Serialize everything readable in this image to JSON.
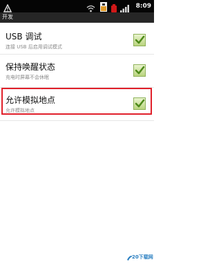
{
  "status_bar": {
    "time": "8:09",
    "icons": [
      "notification-icon",
      "wifi-icon",
      "battery-saver-icon",
      "battery-icon",
      "signal-icon"
    ]
  },
  "title_bar": {
    "title": "开发"
  },
  "settings": [
    {
      "title": "USB 调试",
      "subtitle": "连接 USB 后启用调试模式",
      "checked": true
    },
    {
      "title": "保持唤醒状态",
      "subtitle": "充电时屏幕不会休眠",
      "checked": true
    },
    {
      "title": "允许模拟地点",
      "subtitle": "允许模拟地点",
      "checked": true,
      "highlighted": true
    }
  ],
  "watermark": {
    "text": "20下载网"
  },
  "colors": {
    "status_bar": "#050505",
    "title_bar": "#262626",
    "highlight": "#e0202a",
    "checkbox": "#9fc36a"
  }
}
